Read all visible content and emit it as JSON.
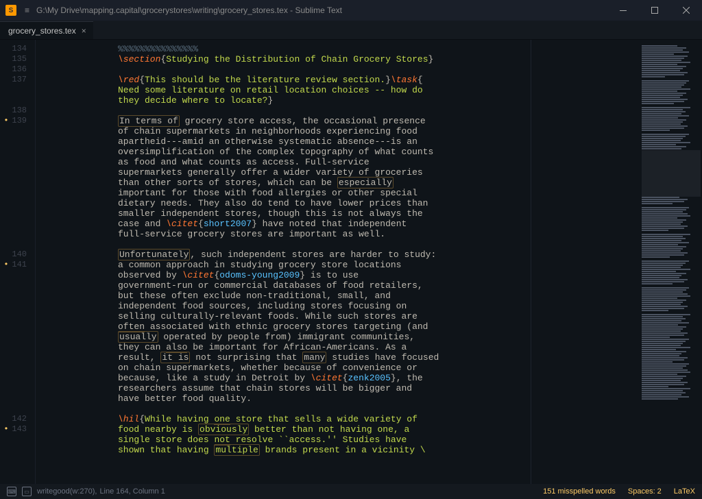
{
  "titlebar": {
    "path": "G:\\My Drive\\mapping.capital\\grocerystores\\writing\\grocery_stores.tex - Sublime Text"
  },
  "tab": {
    "name": "grocery_stores.tex",
    "close": "×"
  },
  "lines": {
    "l134": "134",
    "l135": "135",
    "l136": "136",
    "l137": "137",
    "l138": "138",
    "l139": "139",
    "l140": "140",
    "l141": "141",
    "l142": "142",
    "l143": "143"
  },
  "code": {
    "pctline": "%%%%%%%%%%%%%%%",
    "section_cmd": "\\section",
    "section_arg": "Studying the Distribution of Chain Grocery Stores",
    "red_cmd": "\\red",
    "red_arg": "This should be the literature review section.",
    "task_cmd": "\\task",
    "task_arg_a": "Need some literature on retail location choices -- how do",
    "task_arg_b": "they decide where to locate?",
    "p139_a": "In terms of",
    "p139_b": " grocery store access, the occasional presence",
    "p139_c": "of chain supermarkets in neighborhoods experiencing food",
    "p139_d": "apartheid---amid an otherwise systematic absence---is an",
    "p139_e": "oversimplification of the complex topography of what counts",
    "p139_f": "as food and what counts as access. Full-service",
    "p139_g": "supermarkets generally offer a wider variety of groceries",
    "p139_h": "than other sorts of stores, which can be ",
    "p139_h_hl": "especially",
    "p139_i": "important for those with food allergies or other special",
    "p139_j": "dietary needs. They also do tend to have lower prices than",
    "p139_k": "smaller independent stores, though this is not always the",
    "p139_l": "case and ",
    "citet_cmd": "\\citet",
    "cite1": "short2007",
    "p139_m": " have noted that independent",
    "p139_n": "full-service grocery stores are important as well.",
    "p141_a_hl": "Unfortunately",
    "p141_a2": ", such independent stores are harder to study:",
    "p141_b": "a common approach in studying grocery store locations",
    "p141_c": "observed by ",
    "cite2": "odoms-young2009",
    "p141_c2": " is to use",
    "p141_d": "government-run or commercial databases of food retailers,",
    "p141_e": "but these often exclude non-traditional, small, and",
    "p141_f": "independent food sources, including stores focusing on",
    "p141_g": "selling culturally-relevant foods. While such stores are",
    "p141_h_u": "often",
    "p141_h2": " associated with ethnic grocery stores targeting (and",
    "p141_i_u": "usually",
    "p141_i2": " operated by people from) immigrant communities,",
    "p141_j": "they can ",
    "p141_j_u": "also",
    "p141_j2": " be important for African-Americans. As a",
    "p141_k": "result, ",
    "p141_k_hl": "it is",
    "p141_k2": " not surprising that ",
    "p141_k_hl2": "many",
    "p141_k3": " studies have focused",
    "p141_l": "on chain supermarkets, whether because of convenience or",
    "p141_m": "because, like a study in Detroit by ",
    "cite3": "zenk2005",
    "p141_m2": ", the",
    "p141_n": "researchers assume that chain stores will be bigger and",
    "p141_o": "have better food quality.",
    "hil_cmd": "\\hil",
    "p143_a": "While having ",
    "p143_a_u": "one",
    "p143_a2": " store that sells a wide variety of",
    "p143_b": "food nearby is ",
    "p143_b_hl": "obviously",
    "p143_b2": " better than not having one, a",
    "p143_c": "single store does ",
    "p143_c_u": "not",
    "p143_c2": " resolve ``access.'' Studies have",
    "p143_d": "shown that having ",
    "p143_d_hl": "multiple",
    "p143_d2": " brands present in a vicinity \\"
  },
  "status": {
    "writegood": "writegood(w:270),",
    "line_col": "Line 164, Column 1",
    "misspelled": "151 misspelled words",
    "spaces": "Spaces: 2",
    "syntax": "LaTeX"
  }
}
